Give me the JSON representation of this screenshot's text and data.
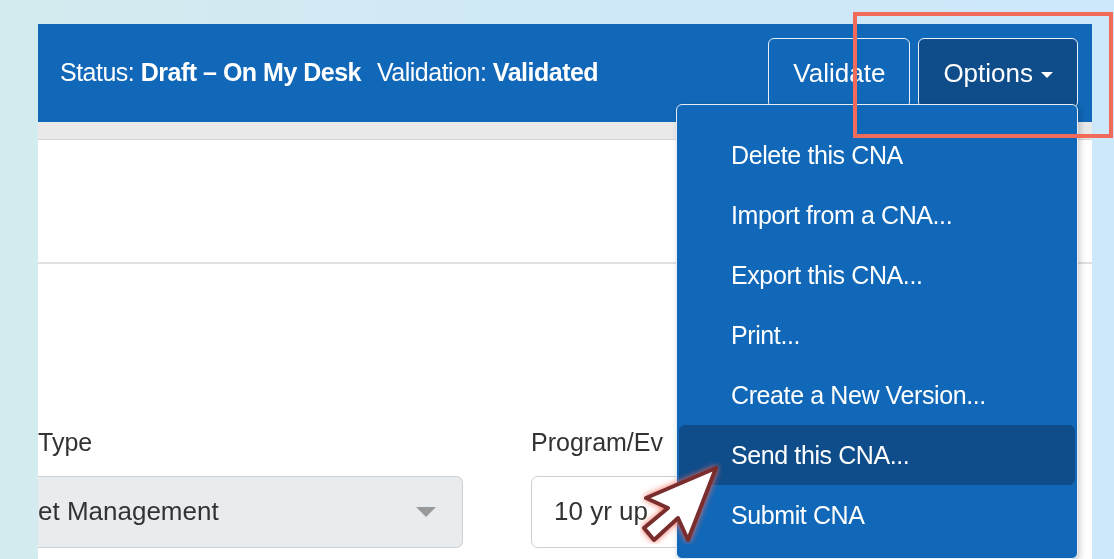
{
  "header": {
    "status": "Status: **Draft – On My Desk**",
    "validation": "Validation: **Validated**",
    "buttons": [
      {
        "label": "Validate",
        "kind": "plain",
        "expanded": false
      },
      {
        "label": "Options",
        "kind": "dropdown",
        "expanded": true
      }
    ]
  },
  "menu": {
    "items": [
      {
        "label": "Delete this CNA",
        "selected": false
      },
      {
        "label": "Import from a CNA...",
        "selected": false
      },
      {
        "label": "Export this CNA...",
        "selected": false
      },
      {
        "label": "Print...",
        "selected": false
      },
      {
        "label": "Create a New Version...",
        "selected": false
      },
      {
        "label": "Send this CNA...",
        "selected": true
      },
      {
        "label": "Submit CNA",
        "selected": false
      }
    ]
  },
  "form": {
    "fields": [
      {
        "label": "Type",
        "value": "et Management",
        "kind": "select",
        "disabled": true
      },
      {
        "label": "Program/Ev",
        "value": "10 yr up",
        "kind": "text",
        "disabled": false
      }
    ]
  }
}
